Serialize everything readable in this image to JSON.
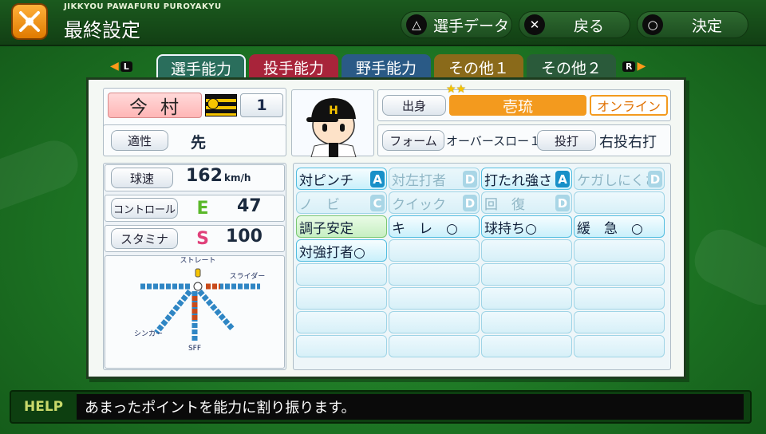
{
  "header": {
    "game_title": "JIKKYOU PAWAFURU PUROYAKYU",
    "screen_title": "最終設定",
    "buttons": [
      {
        "symbol": "△",
        "label": "選手データ"
      },
      {
        "symbol": "✕",
        "label": "戻る"
      },
      {
        "symbol": "○",
        "label": "決定"
      }
    ]
  },
  "tabs": {
    "left_key": "L",
    "right_key": "R",
    "items": [
      {
        "label": "選手能力",
        "color": "#2a6e5c",
        "selected": true
      },
      {
        "label": "投手能力",
        "color": "#a8243a"
      },
      {
        "label": "野手能力",
        "color": "#2a5a86"
      },
      {
        "label": "その他１",
        "color": "#8a6a1a"
      },
      {
        "label": "その他２",
        "color": "#2a5a3a"
      }
    ]
  },
  "player": {
    "name": "今村",
    "number": "1",
    "aptitude_label": "適性",
    "aptitude_value": "先",
    "origin_label": "出身",
    "origin_value": "壱琉",
    "origin_tag": "オンライン",
    "stars": "★★",
    "form_label": "フォーム",
    "form_value": "オーバースロー１",
    "throw_bat_label": "投打",
    "throw_bat_value": "右投右打"
  },
  "pitching": {
    "speed_label": "球速",
    "speed_value": "162",
    "speed_unit": "km/h",
    "control_label": "コントロール",
    "control_grade": "E",
    "control_value": "47",
    "stamina_label": "スタミナ",
    "stamina_grade": "S",
    "stamina_value": "100",
    "chart_labels": {
      "top": "ストレート",
      "right": "スライダー",
      "left_bottom": "シンカー",
      "bottom": "SFF"
    }
  },
  "abilities": {
    "rows": [
      [
        {
          "label": "対ピンチ",
          "rank": "A",
          "style": "active"
        },
        {
          "label": "対左打者",
          "rank": "D",
          "style": "faded"
        },
        {
          "label": "打たれ強さ",
          "rank": "A",
          "style": "active"
        },
        {
          "label": "ケガしにくさ",
          "rank": "D",
          "style": "faded"
        }
      ],
      [
        {
          "label": "ノ　ビ",
          "rank": "C",
          "style": "faded"
        },
        {
          "label": "クイック",
          "rank": "D",
          "style": "faded"
        },
        {
          "label": "回　復",
          "rank": "D",
          "style": "faded"
        },
        {
          "label": "",
          "rank": "",
          "style": "empty"
        }
      ],
      [
        {
          "label": "調子安定",
          "style": "green"
        },
        {
          "label": "キ　レ　○",
          "style": "active"
        },
        {
          "label": "球持ち○",
          "style": "active"
        },
        {
          "label": "緩　急　○",
          "style": "active"
        }
      ],
      [
        {
          "label": "対強打者○",
          "style": "active"
        },
        {
          "label": "",
          "style": "empty"
        },
        {
          "label": "",
          "style": "empty"
        },
        {
          "label": "",
          "style": "empty"
        }
      ]
    ]
  },
  "help": {
    "label": "HELP",
    "text": "あまったポイントを能力に割り振ります。"
  }
}
